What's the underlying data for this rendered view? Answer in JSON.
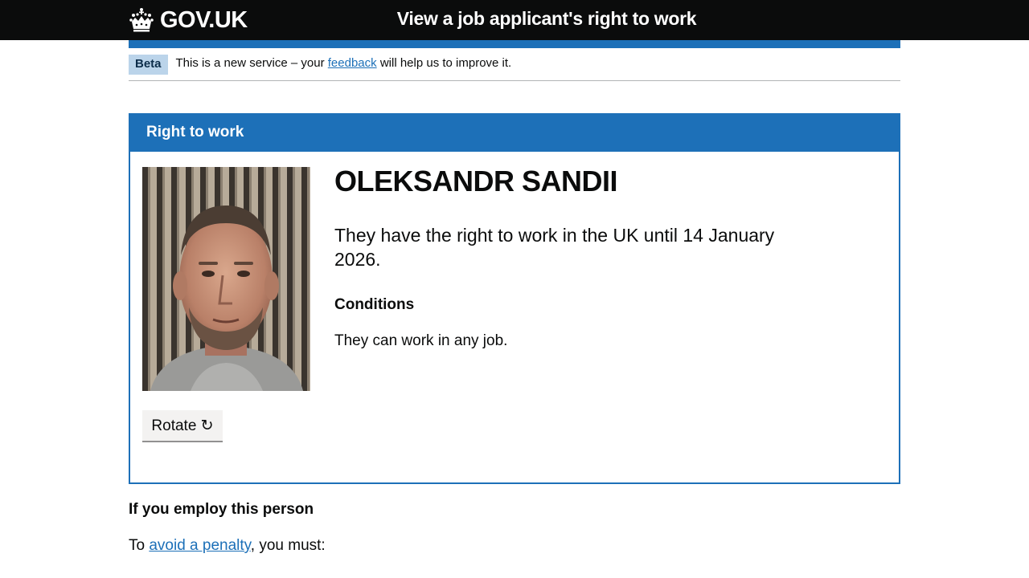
{
  "header": {
    "logo_text": "GOV.UK",
    "service_name": "View a job applicant's right to work"
  },
  "phase_banner": {
    "tag": "Beta",
    "text_before": "This is a new service – your ",
    "link": "feedback",
    "text_after": " will help us to improve it."
  },
  "panel": {
    "title": "Right to work",
    "person_name": "OLEKSANDR SANDII",
    "statement": "They have the right to work in the UK until 14 January 2026.",
    "conditions_heading": "Conditions",
    "conditions_text": "They can work in any job.",
    "rotate_label": "Rotate ↻"
  },
  "employ": {
    "heading": "If you employ this person",
    "text_before": "To ",
    "link": "avoid a penalty",
    "text_after": ", you must:"
  },
  "colors": {
    "header_bg": "#0b0c0c",
    "brand_blue": "#1d70b8",
    "beta_tag_bg": "#bbd4ea",
    "button_bg": "#f3f2f1"
  },
  "icons": [
    "crown-icon",
    "rotate-icon"
  ]
}
